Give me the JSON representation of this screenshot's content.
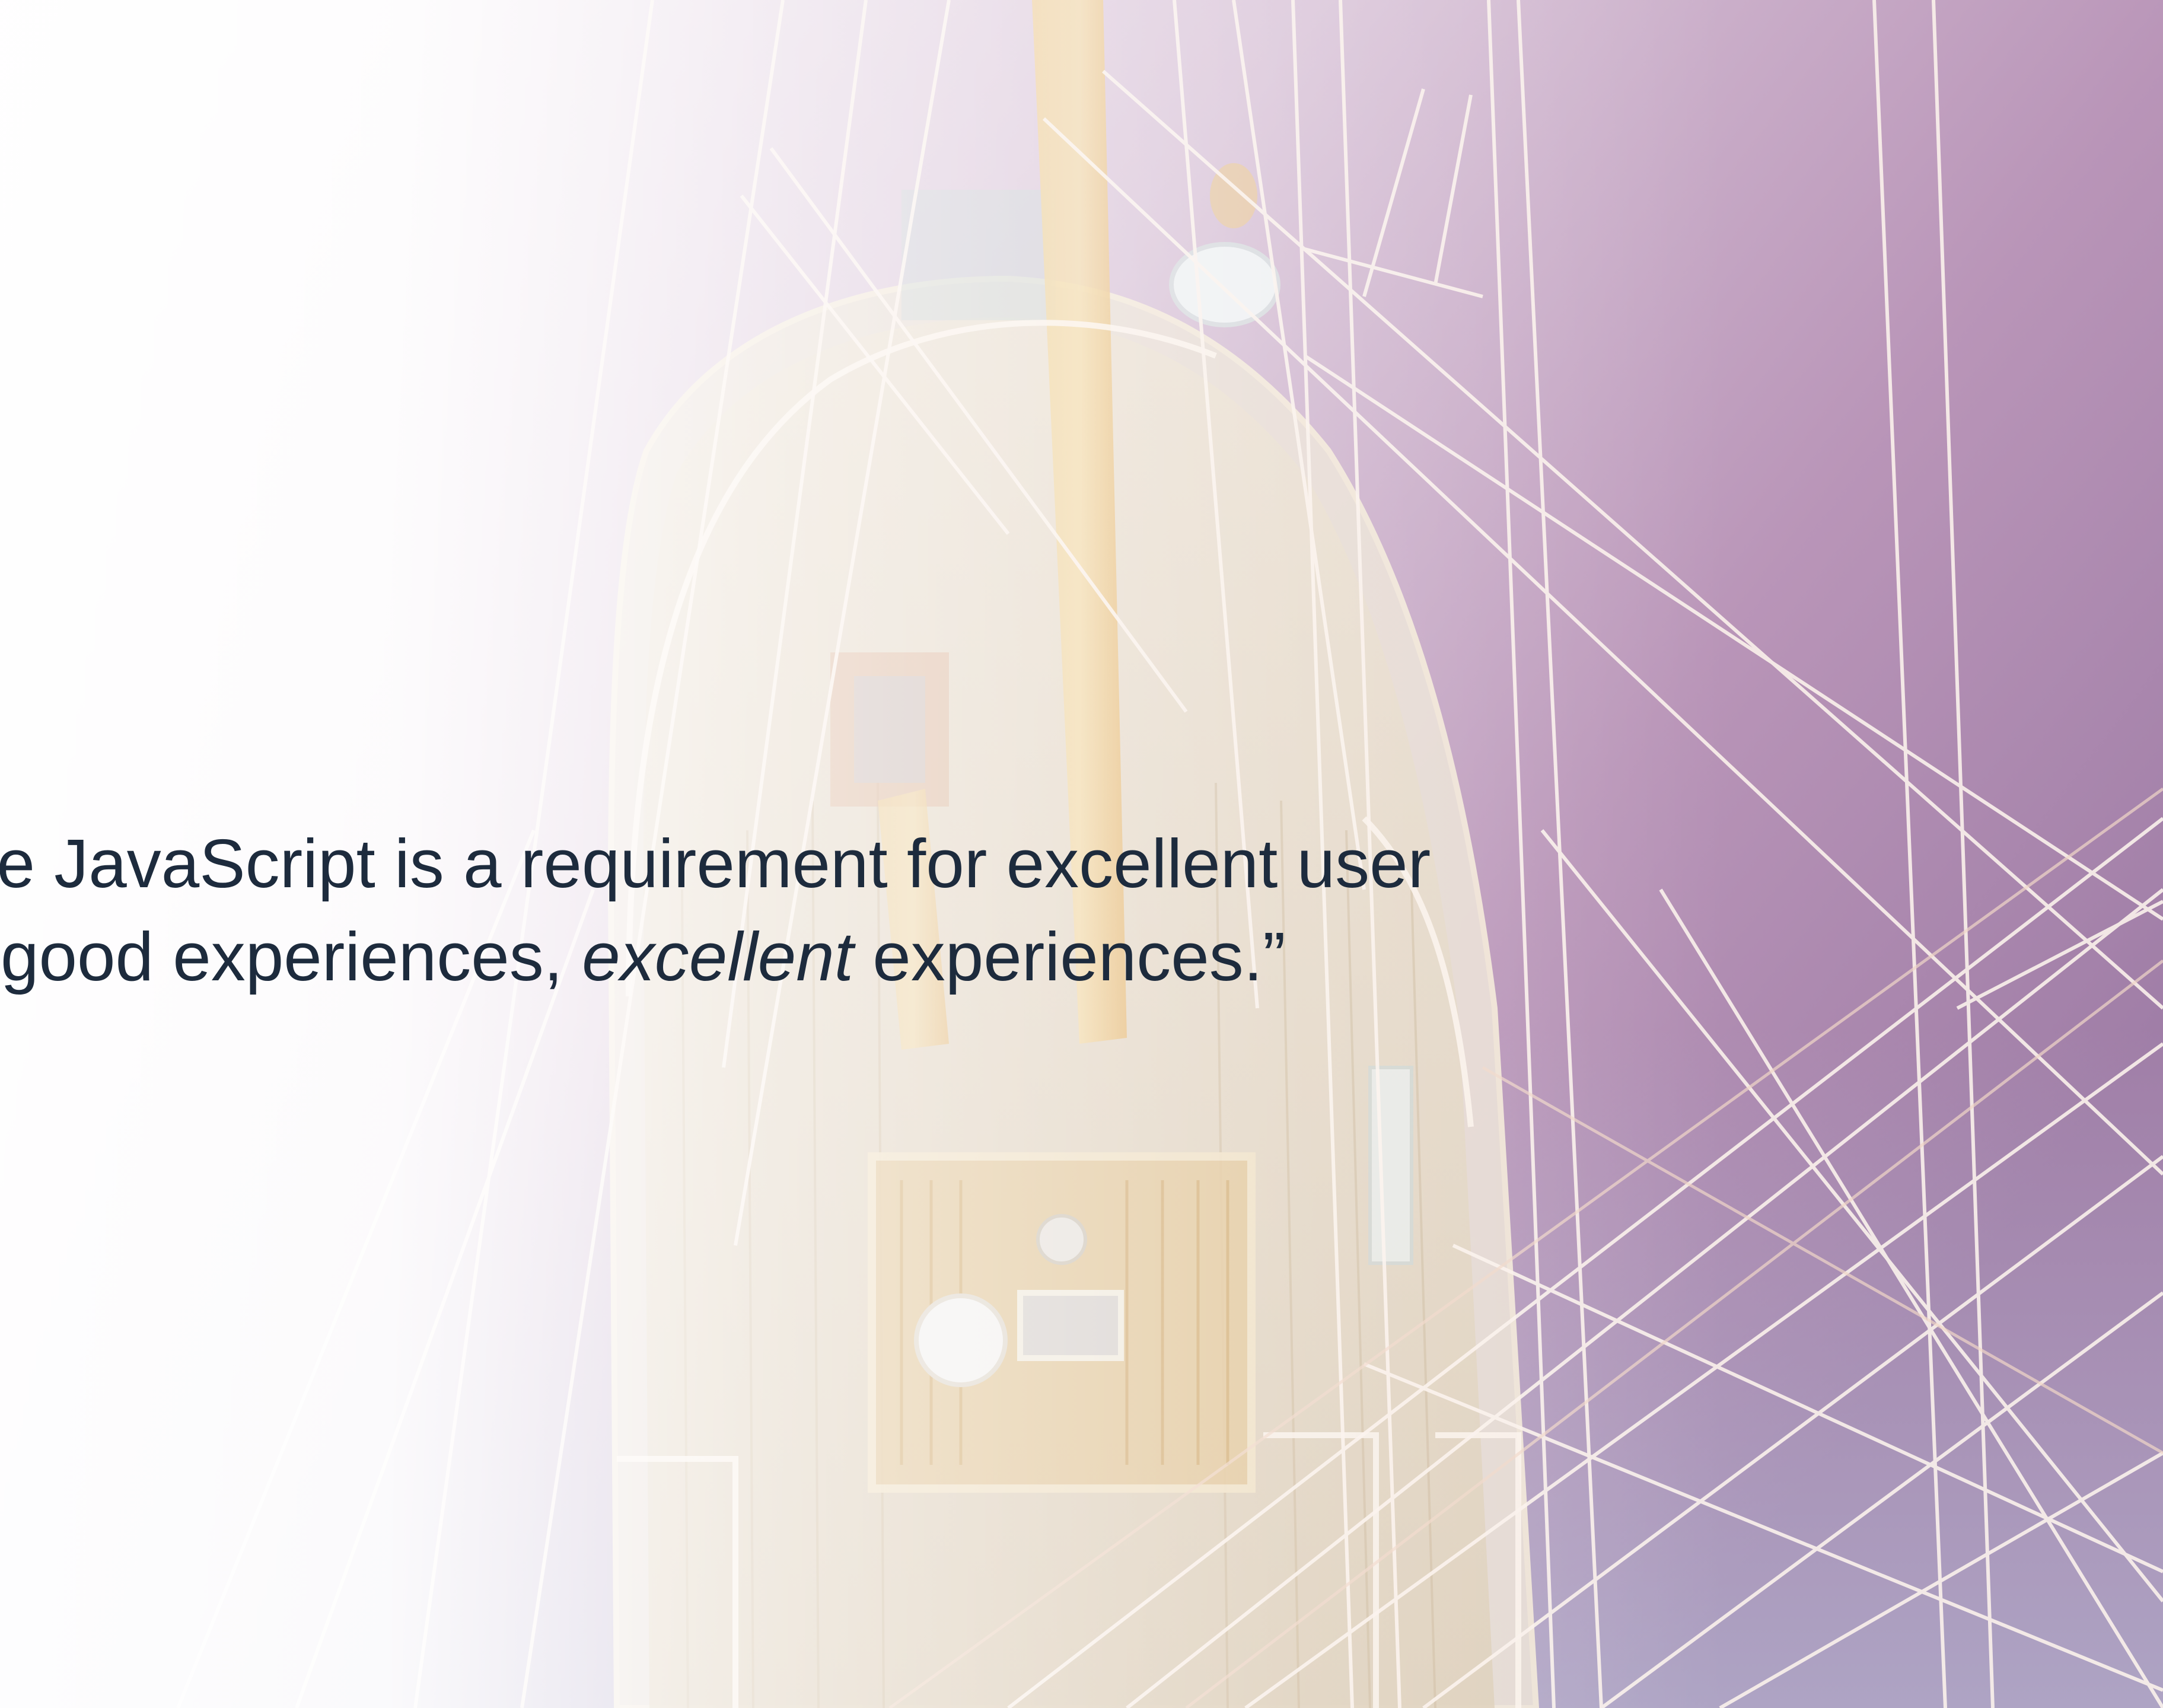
{
  "quote": {
    "line1": "eve JavaScript is a requirement for excellent user",
    "line2_before": "ot good experiences, ",
    "line2_emphasis": "excellent",
    "line2_after": " experiences.”"
  },
  "background": {
    "subject": "aerial view of a tall ship's deck and rigging over the sea",
    "colors": {
      "sea": "#b391b3",
      "sea_deep": "#8f6f95",
      "deck": "#d9c9ad",
      "mast": "#e8b86a",
      "rope": "#fbeee6",
      "text": "#1d2b3d"
    }
  }
}
